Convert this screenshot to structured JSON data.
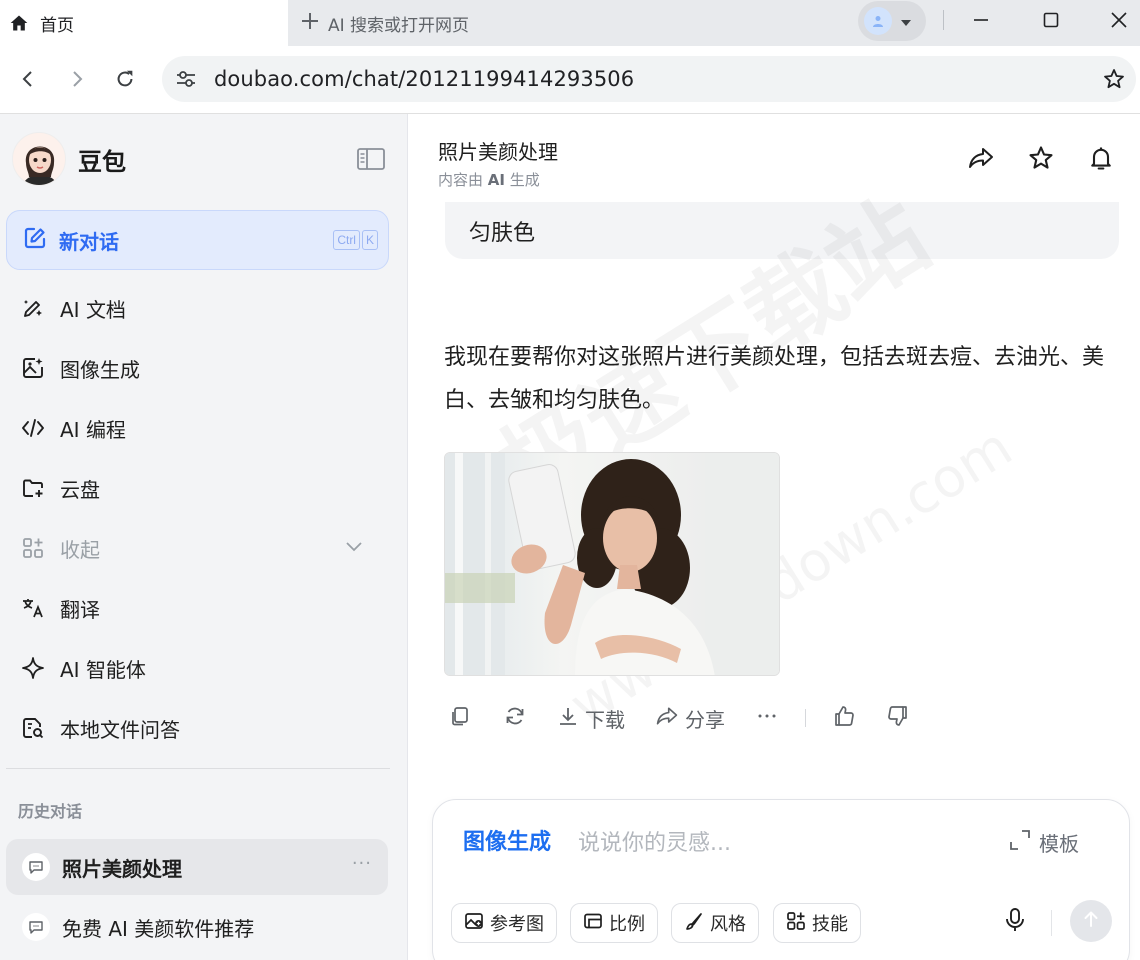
{
  "browser": {
    "active_tab_title": "首页",
    "new_tab_label": "AI 搜索或打开网页",
    "url": "doubao.com/chat/20121199414293506"
  },
  "sidebar": {
    "brand": "豆包",
    "new_chat": {
      "label": "新对话",
      "shortcut_ctrl": "Ctrl",
      "shortcut_key": "K"
    },
    "items": [
      {
        "label": "AI 文档",
        "icon": "pen-sparkle-icon"
      },
      {
        "label": "图像生成",
        "icon": "image-sparkle-icon"
      },
      {
        "label": "AI 编程",
        "icon": "code-icon"
      },
      {
        "label": "云盘",
        "icon": "folder-icon"
      },
      {
        "label": "收起",
        "icon": "grid-icon"
      },
      {
        "label": "翻译",
        "icon": "translate-icon"
      },
      {
        "label": "AI 智能体",
        "icon": "sparkle-icon"
      },
      {
        "label": "本地文件问答",
        "icon": "file-search-icon"
      }
    ],
    "history_title": "历史对话",
    "history": [
      {
        "label": "照片美颜处理",
        "active": true
      },
      {
        "label": "免费 AI 美颜软件推荐",
        "active": false
      }
    ]
  },
  "chat": {
    "title": "照片美颜处理",
    "subtitle_prefix": "内容由 ",
    "subtitle_ai": "AI",
    "subtitle_suffix": " 生成",
    "bubble_text": "匀肤色",
    "message": "我现在要帮你对这张照片进行美颜处理，包括去斑去痘、去油光、美白、去皱和均匀肤色。",
    "actions": {
      "download": "下载",
      "share": "分享"
    }
  },
  "composer": {
    "mode": "图像生成",
    "placeholder": "说说你的灵感...",
    "template": "模板",
    "chips": [
      "参考图",
      "比例",
      "风格",
      "技能"
    ]
  },
  "watermark": {
    "line1": "极速下载站",
    "line2": "www.mydown.com"
  },
  "colors": {
    "accent": "#2f6bf2",
    "composer_mode": "#1d6ef0",
    "sidebar_bg": "#f3f4f6",
    "newchat_bg": "#e3ebfd"
  }
}
